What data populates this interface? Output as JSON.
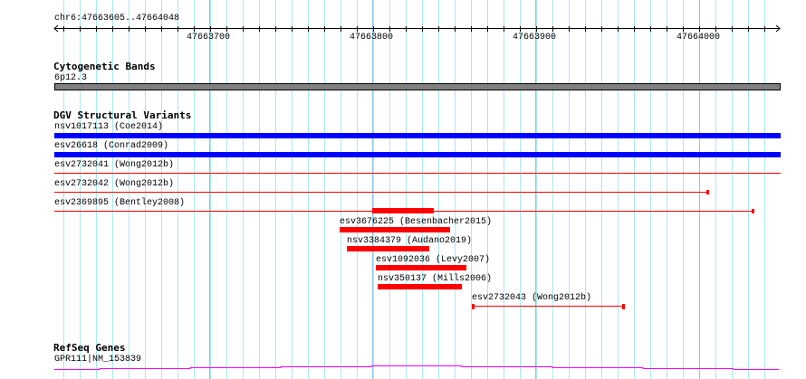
{
  "ruler": {
    "location": "chr6:47663605..47664048",
    "ticks": [
      "47663700",
      "47663800",
      "47663900",
      "47664000"
    ]
  },
  "tracks": {
    "cytoband": {
      "title": "Cytogenetic Bands",
      "label": "6p12.3"
    },
    "dgv": {
      "title": "DGV Structural Variants",
      "features": [
        {
          "label": "nsv1017113 (Coe2014)"
        },
        {
          "label": "esv26618 (Conrad2009)"
        },
        {
          "label": "esv2732041 (Wong2012b)"
        },
        {
          "label": "esv2732042 (Wong2012b)"
        },
        {
          "label": "esv2369895 (Bentley2008)"
        },
        {
          "label": "esv3676225 (Besenbacher2015)"
        },
        {
          "label": "nsv3384379 (Audano2019)"
        },
        {
          "label": "esv1092036 (Levy2007)"
        },
        {
          "label": "nsv350137 (Mills2006)"
        },
        {
          "label": "esv2732043 (Wong2012b)"
        }
      ]
    },
    "refseq": {
      "title": "RefSeq Genes",
      "label": "GPR111|NM_153839"
    }
  },
  "colors": {
    "gain": "#0000ff",
    "loss": "#ff0000",
    "gene": "#ff00ff",
    "band": "#808080",
    "grid": "#a8e8f0",
    "grid_major": "#88c8e8"
  }
}
